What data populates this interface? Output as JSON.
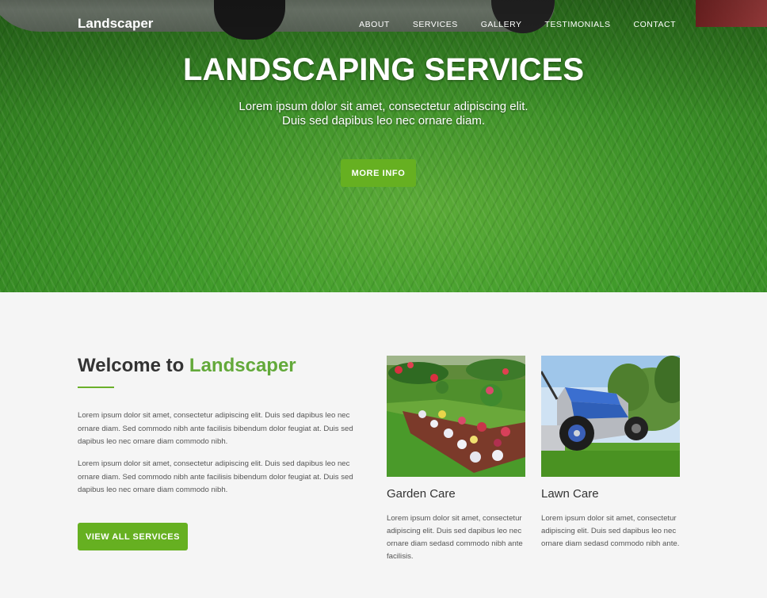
{
  "header": {
    "brand": "Landscaper",
    "nav": [
      "ABOUT",
      "SERVICES",
      "GALLERY",
      "TESTIMONIALS",
      "CONTACT"
    ]
  },
  "hero": {
    "title": "LANDSCAPING SERVICES",
    "subtitle_line1": "Lorem ipsum dolor sit amet, consectetur adipiscing elit.",
    "subtitle_line2": "Duis sed dapibus leo nec ornare diam.",
    "button_label": "MORE INFO"
  },
  "welcome": {
    "heading_prefix": "Welcome to ",
    "heading_accent": "Landscaper",
    "paragraph1": "Lorem ipsum dolor sit amet, consectetur adipiscing elit. Duis sed dapibus leo nec ornare diam. Sed commodo nibh ante facilisis bibendum dolor feugiat at. Duis sed dapibus leo nec ornare diam commodo nibh.",
    "paragraph2": "Lorem ipsum dolor sit amet, consectetur adipiscing elit. Duis sed dapibus leo nec ornare diam. Sed commodo nibh ante facilisis bibendum dolor feugiat at. Duis sed dapibus leo nec ornare diam commodo nibh.",
    "button_label": "VIEW ALL SERVICES"
  },
  "services": [
    {
      "title": "Garden Care",
      "text": "Lorem ipsum dolor sit amet, consectetur adipiscing elit. Duis sed dapibus leo nec ornare diam sedasd commodo nibh ante facilisis."
    },
    {
      "title": "Lawn Care",
      "text": "Lorem ipsum dolor sit amet, consectetur adipiscing elit. Duis sed dapibus leo nec ornare diam sedasd commodo nibh ante."
    }
  ],
  "colors": {
    "accent": "#66b021",
    "heading_accent": "#63a93a",
    "background": "#f5f5f5"
  }
}
